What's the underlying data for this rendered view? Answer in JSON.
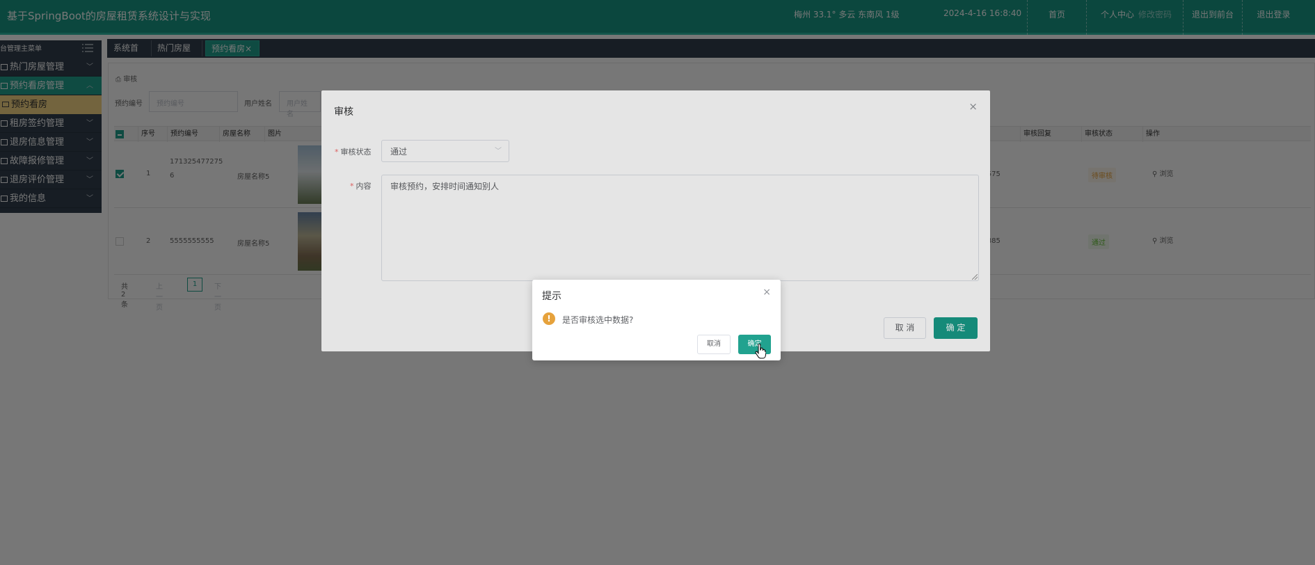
{
  "header": {
    "title": "基于SpringBoot的房屋租赁系统设计与实现",
    "weather": "梅州  33.1°  多云  东南风  1级",
    "datetime": "2024-4-16 16:8:40",
    "nav": {
      "home": "首页",
      "profile": "个人中心",
      "profile_ghost": "修改密码",
      "front": "退出到前台",
      "logout": "退出登录"
    }
  },
  "sidebar": {
    "heading": "台管理主菜单",
    "items": [
      {
        "label": "热门房屋管理"
      },
      {
        "label": "预约看房管理"
      },
      {
        "label": "租房签约管理"
      },
      {
        "label": "退房信息管理"
      },
      {
        "label": "故障报修管理"
      },
      {
        "label": "退房评价管理"
      },
      {
        "label": "我的信息"
      }
    ],
    "sub_item": "预约看房"
  },
  "tabs": [
    "系统首页",
    "热门房屋",
    "预约看房"
  ],
  "tab_close": "×",
  "breadcrumb": "审核",
  "search": {
    "order_label": "预约编号",
    "order_placeholder": "预约编号",
    "user_label": "用户姓名",
    "user_placeholder": "用户姓名"
  },
  "table": {
    "columns": [
      "序号",
      "预约编号",
      "房屋名称",
      "图片",
      "审核回复",
      "审核状态",
      "操作"
    ],
    "rows": [
      {
        "index": "1",
        "order_no_line1": "171325477275",
        "order_no_line2": "6",
        "house_name": "房屋名称5",
        "phone_tail": "87575",
        "status": "待审核",
        "action": "浏览"
      },
      {
        "index": "2",
        "order_no_line1": "5555555555",
        "order_no_line2": "",
        "house_name": "房屋名称5",
        "phone_tail": "88885",
        "status": "通过",
        "action": "浏览"
      }
    ]
  },
  "pager": {
    "total": "共 2 条",
    "prev": "上一页",
    "current": "1",
    "next": "下一页"
  },
  "audit_dialog": {
    "title": "审核",
    "close": "×",
    "status_label": "审核状态",
    "status_value": "通过",
    "content_label": "内容",
    "content_value": "审核预约，安排时间通知别人",
    "required_mark": "*",
    "cancel": "取 消",
    "confirm": "确 定"
  },
  "confirm_dialog": {
    "title": "提示",
    "close": "×",
    "icon": "!",
    "message": "是否审核选中数据?",
    "cancel": "取消",
    "confirm": "确定"
  },
  "colors": {
    "primary": "#199a87",
    "sidebar": "#33404f",
    "warning": "#e6a23c",
    "success": "#67c23a"
  }
}
